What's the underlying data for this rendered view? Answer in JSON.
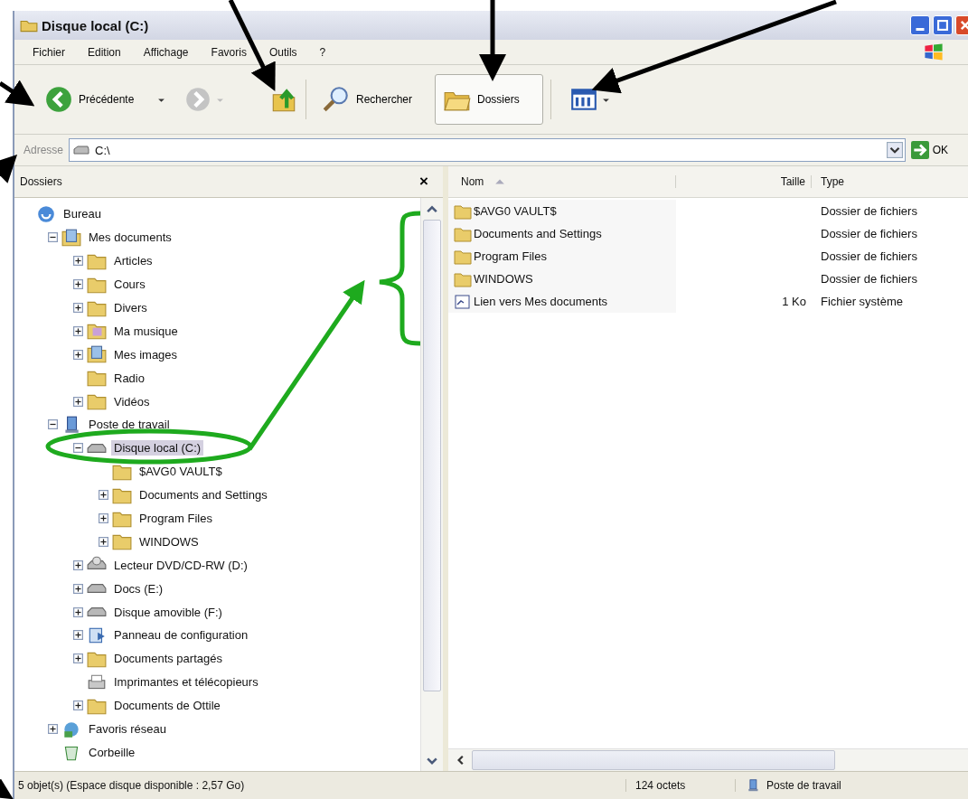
{
  "window": {
    "title": "Disque local (C:)"
  },
  "menu": [
    "Fichier",
    "Edition",
    "Affichage",
    "Favoris",
    "Outils",
    "?"
  ],
  "toolbar": {
    "back": "Précédente",
    "search": "Rechercher",
    "folders": {
      "label": "Dossiers",
      "selected": true
    }
  },
  "address": {
    "label": "Adresse",
    "value": "C:\\",
    "go": "OK"
  },
  "folders_pane": {
    "title": "Dossiers",
    "close": "×"
  },
  "tree": {
    "items": [
      {
        "label": "Bureau",
        "kind": "desktop",
        "selected": false,
        "children": [
          {
            "label": "Mes documents",
            "kind": "documents",
            "expanded": true,
            "selected": false,
            "children": [
              {
                "label": "Articles",
                "kind": "folder",
                "expanded": false,
                "selected": false
              },
              {
                "label": "Cours",
                "kind": "folder",
                "expanded": false,
                "selected": false
              },
              {
                "label": "Divers",
                "kind": "folder",
                "expanded": false,
                "selected": false
              },
              {
                "label": "Ma musique",
                "kind": "music",
                "expanded": false,
                "selected": false
              },
              {
                "label": "Mes images",
                "kind": "pictures",
                "expanded": false,
                "selected": false
              },
              {
                "label": "Radio",
                "kind": "folder",
                "selected": false
              },
              {
                "label": "Vidéos",
                "kind": "folder",
                "expanded": false,
                "selected": false
              }
            ]
          },
          {
            "label": "Poste de travail",
            "kind": "computer",
            "expanded": true,
            "selected": false,
            "children": [
              {
                "label": "Disque local (C:)",
                "kind": "drive",
                "expanded": true,
                "selected": true,
                "children": [
                  {
                    "label": "$AVG0 VAULT$",
                    "kind": "folder",
                    "selected": false
                  },
                  {
                    "label": "Documents and Settings",
                    "kind": "folder",
                    "expanded": false,
                    "selected": false
                  },
                  {
                    "label": "Program Files",
                    "kind": "folder",
                    "expanded": false,
                    "selected": false
                  },
                  {
                    "label": "WINDOWS",
                    "kind": "folder",
                    "expanded": false,
                    "selected": false
                  }
                ]
              },
              {
                "label": "Lecteur DVD/CD-RW (D:)",
                "kind": "cd",
                "expanded": false,
                "selected": false
              },
              {
                "label": "Docs (E:)",
                "kind": "drive",
                "expanded": false,
                "selected": false
              },
              {
                "label": "Disque amovible (F:)",
                "kind": "drive",
                "expanded": false,
                "selected": false
              },
              {
                "label": "Panneau de configuration",
                "kind": "control",
                "expanded": false,
                "selected": false
              },
              {
                "label": "Documents partagés",
                "kind": "folder",
                "expanded": false,
                "selected": false
              },
              {
                "label": "Imprimantes et télécopieurs",
                "kind": "printer",
                "selected": false
              },
              {
                "label": "Documents de Ottile",
                "kind": "folder",
                "expanded": false,
                "selected": false
              }
            ]
          },
          {
            "label": "Favoris réseau",
            "kind": "network",
            "expanded": false,
            "selected": false
          },
          {
            "label": "Corbeille",
            "kind": "trash",
            "selected": false
          }
        ]
      }
    ]
  },
  "table": {
    "columns": [
      "Nom",
      "Taille",
      "Type"
    ],
    "rows": [
      {
        "kind": "folder",
        "name": "$AVG0 VAULT$",
        "type": "Dossier de fichiers"
      },
      {
        "kind": "folder",
        "name": "Documents and Settings",
        "type": "Dossier de fichiers"
      },
      {
        "kind": "folder",
        "name": "Program Files",
        "type": "Dossier de fichiers"
      },
      {
        "kind": "folder",
        "name": "WINDOWS",
        "type": "Dossier de fichiers"
      },
      {
        "kind": "file",
        "name": "Lien vers Mes documents",
        "size": "1 Ko",
        "type": "Fichier système"
      }
    ]
  },
  "status_bar": {
    "text": "5 objet(s) (Espace disque disponible : 2,57 Go)",
    "size": "124 octets",
    "location": "Poste de travail"
  }
}
